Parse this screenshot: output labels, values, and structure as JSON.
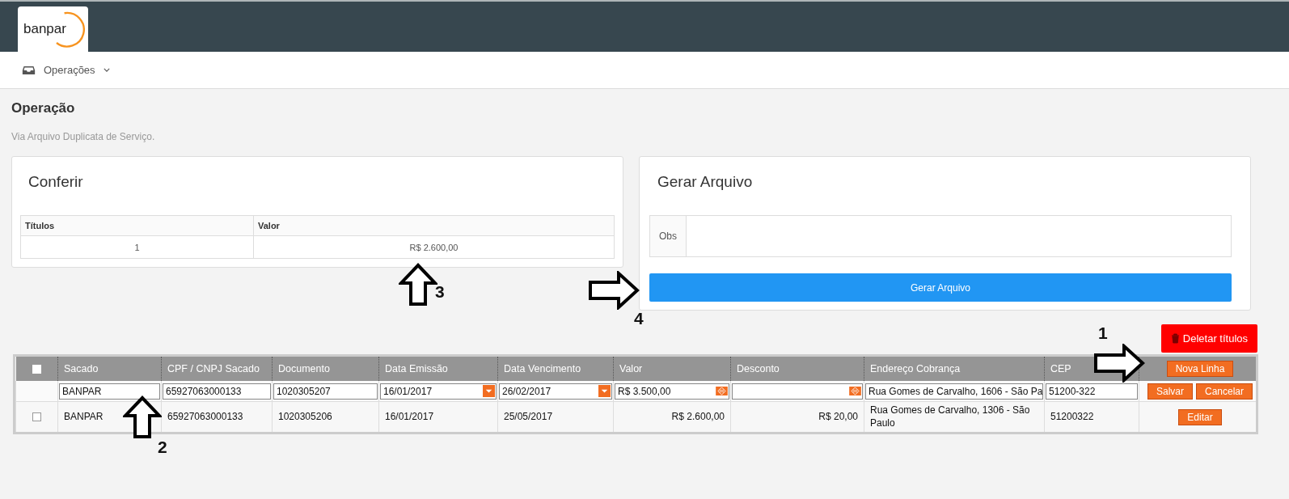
{
  "header": {
    "logo": "banpar"
  },
  "nav": {
    "items": [
      {
        "label": "Operações",
        "expanded": false
      }
    ]
  },
  "page": {
    "title": "Operação",
    "subtitle": "Via Arquivo Duplicata de Serviço."
  },
  "conferir": {
    "title": "Conferir",
    "columns": [
      "Títulos",
      "Valor"
    ],
    "rows": [
      [
        "1",
        "R$ 2.600,00"
      ]
    ]
  },
  "gerar": {
    "title": "Gerar Arquivo",
    "obs_label": "Obs",
    "button": "Gerar Arquivo"
  },
  "delete_button": "Deletar títulos",
  "grid": {
    "select_all": false,
    "columns": [
      "Sacado",
      "CPF / CNPJ Sacado",
      "Documento",
      "Data Emissão",
      "Data Vencimento",
      "Valor",
      "Desconto",
      "Endereço Cobrança",
      "CEP"
    ],
    "new_button": "Nova Linha",
    "rows": [
      {
        "kind": "edit",
        "cells": [
          {
            "kind": "text",
            "value": "BANPAR"
          },
          {
            "kind": "text",
            "value": "65927063000133"
          },
          {
            "kind": "text",
            "value": "1020305207"
          },
          {
            "kind": "date",
            "value": "16/01/2017"
          },
          {
            "kind": "date",
            "value": "26/02/2017"
          },
          {
            "kind": "number",
            "value": "R$ 3.500,00"
          },
          {
            "kind": "number"
          },
          {
            "kind": "text",
            "value": "Rua Gomes de Carvalho, 1606 - São Pa"
          },
          {
            "kind": "text",
            "value": "51200-322"
          }
        ],
        "actions": [
          "Salvar",
          "Cancelar"
        ]
      },
      {
        "kind": "view",
        "checked": false,
        "cells": [
          {
            "kind": "text",
            "value": "BANPAR"
          },
          {
            "kind": "text",
            "value": "65927063000133"
          },
          {
            "kind": "text",
            "value": "1020305206"
          },
          {
            "kind": "text",
            "value": "16/01/2017"
          },
          {
            "kind": "text",
            "value": "25/05/2017"
          },
          {
            "kind": "money",
            "value": "R$ 2.600,00"
          },
          {
            "kind": "money",
            "value": "R$ 20,00"
          },
          {
            "kind": "text",
            "value": "Rua Gomes de Carvalho, 1306 - São Paulo"
          },
          {
            "kind": "text",
            "value": "51200322"
          }
        ],
        "actions": [
          "Editar"
        ]
      }
    ]
  },
  "annotations": [
    {
      "label": "3",
      "kind": "up"
    },
    {
      "label": "4",
      "kind": "right"
    },
    {
      "label": "1",
      "kind": "right"
    },
    {
      "label": "2",
      "kind": "up"
    }
  ]
}
